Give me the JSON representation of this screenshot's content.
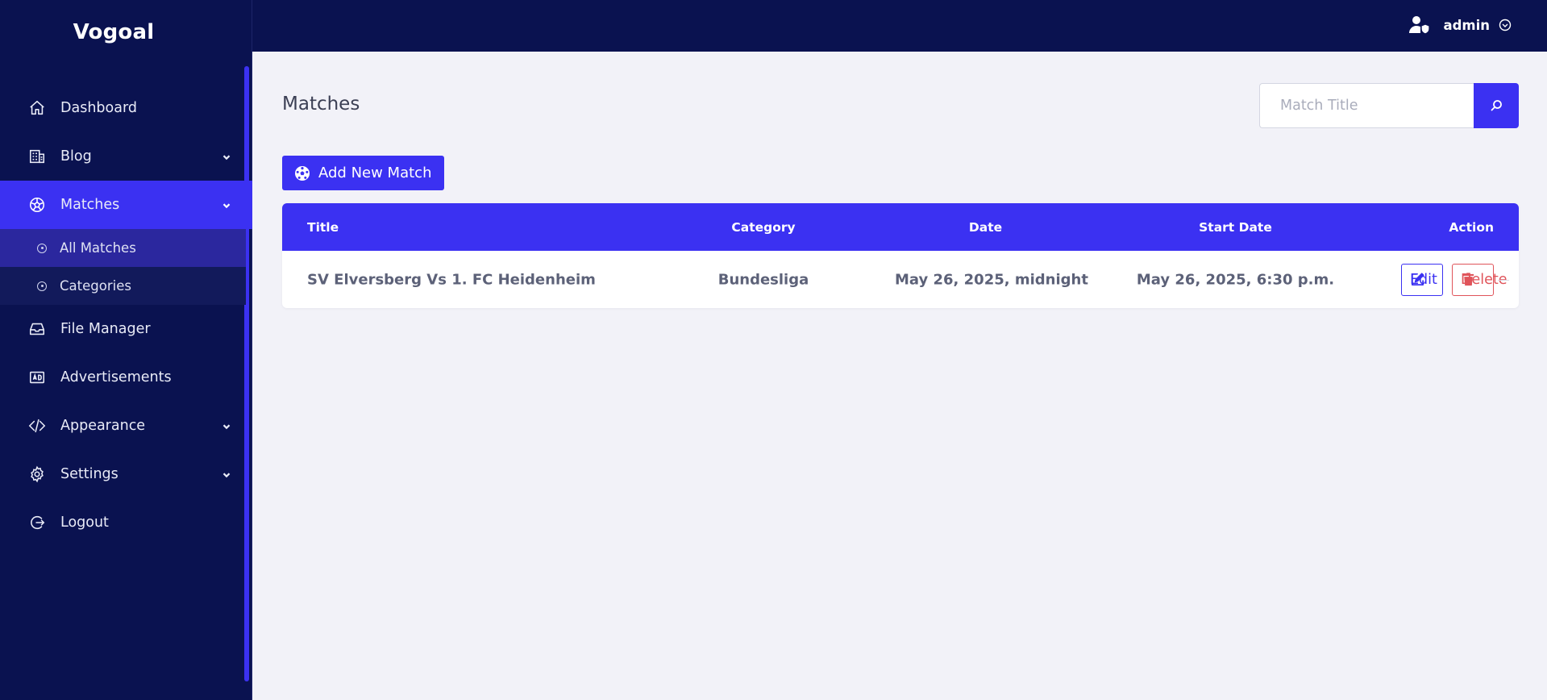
{
  "app": {
    "brand": "Vogoal"
  },
  "user": {
    "name": "admin",
    "icon": "user-shield-icon"
  },
  "sidebar": {
    "items": [
      {
        "label": "Dashboard",
        "icon": "home-icon"
      },
      {
        "label": "Blog",
        "icon": "building-icon"
      },
      {
        "label": "Matches",
        "icon": "soccer-ball-icon"
      },
      {
        "label": "File Manager",
        "icon": "inbox-icon"
      },
      {
        "label": "Advertisements",
        "icon": "ad-icon"
      },
      {
        "label": "Appearance",
        "icon": "code-icon"
      },
      {
        "label": "Settings",
        "icon": "gear-icon"
      },
      {
        "label": "Logout",
        "icon": "logout-icon"
      }
    ],
    "matches_sub": [
      {
        "label": "All Matches"
      },
      {
        "label": "Categories"
      }
    ]
  },
  "main": {
    "title": "Matches",
    "search": {
      "placeholder": "Match Title",
      "value": ""
    },
    "add_button": "Add New Match",
    "table": {
      "headers": {
        "title": "Title",
        "category": "Category",
        "date": "Date",
        "start_date": "Start Date",
        "action": "Action"
      },
      "rows": [
        {
          "title": "SV Elversberg Vs 1. FC Heidenheim",
          "category": "Bundesliga",
          "date": "May 26, 2025, midnight",
          "start_date": "May 26, 2025, 6:30 p.m.",
          "edit_label": "Edit",
          "delete_label": "Delete"
        }
      ]
    }
  },
  "colors": {
    "sidebar": "#0a1250",
    "accent": "#3b31f2",
    "danger": "#e0545a",
    "background": "#f2f2f8"
  }
}
